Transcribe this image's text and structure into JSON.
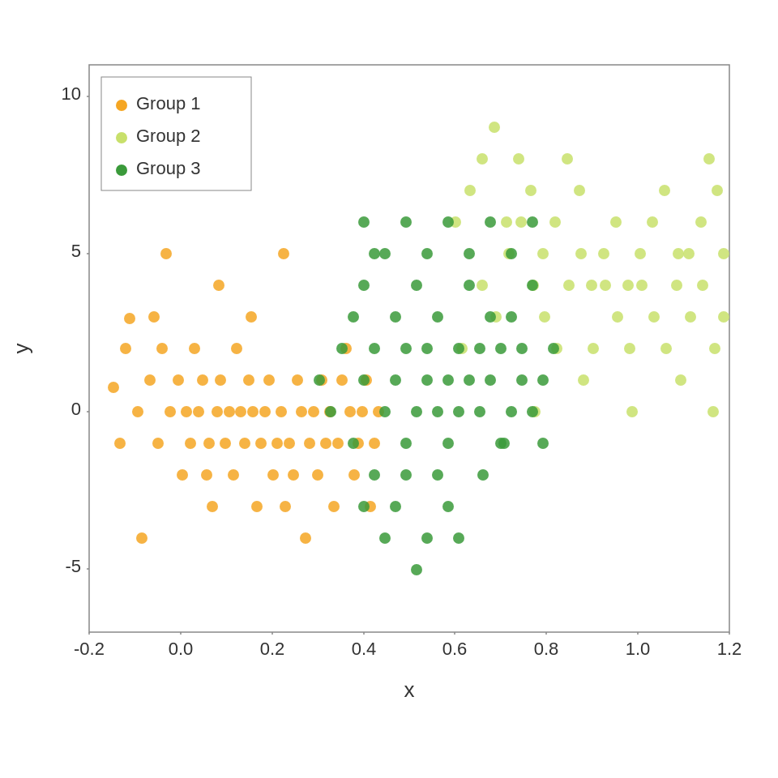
{
  "chart": {
    "title": "",
    "x_label": "x",
    "y_label": "y",
    "x_min": -0.2,
    "x_max": 1.2,
    "y_min": -7,
    "y_max": 11,
    "x_ticks": [
      -0.2,
      0.0,
      0.2,
      0.4,
      0.6,
      0.8,
      1.0,
      1.2
    ],
    "y_ticks": [
      -5,
      0,
      5,
      10
    ],
    "legend": [
      {
        "label": "Group 1",
        "color": "#F5A623"
      },
      {
        "label": "Group 2",
        "color": "#C8E06B"
      },
      {
        "label": "Group 3",
        "color": "#3A9A3A"
      }
    ],
    "groups": {
      "group1_color": "#F5A623",
      "group2_color": "#C8E06B",
      "group3_color": "#3A9A3A"
    }
  }
}
